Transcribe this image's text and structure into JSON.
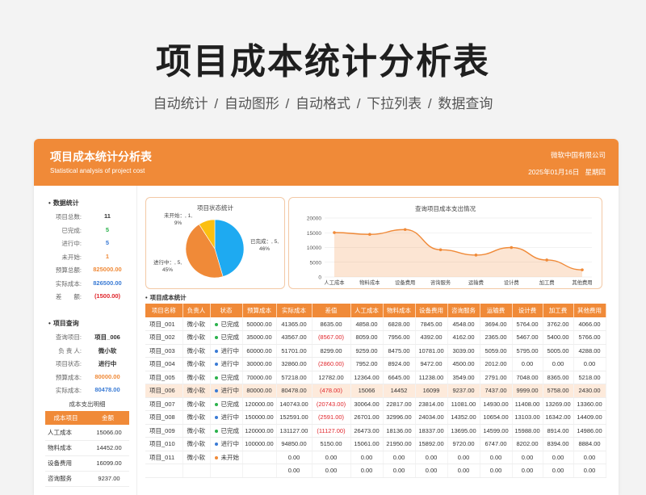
{
  "hero": {
    "title": "项目成本统计分析表",
    "subtitle": "自动统计  /  自动图形   /  自动格式  /  下拉列表  /  数据查询"
  },
  "banner": {
    "title": "项目成本统计分析表",
    "subtitle": "Statistical analysis of project cost",
    "company": "微软中国有限公司",
    "date": "2025年01月16日",
    "weekday": "星期四"
  },
  "stats": {
    "title": "数据统计",
    "items": [
      {
        "label": "项目总数:",
        "value": "11",
        "color": "#333333"
      },
      {
        "label": "已完成:",
        "value": "5",
        "color": "#2bb24c"
      },
      {
        "label": "进行中:",
        "value": "5",
        "color": "#3a7bd5"
      },
      {
        "label": "未开始:",
        "value": "1",
        "color": "#f08a38"
      },
      {
        "label": "预算总额:",
        "value": "825000.00",
        "color": "#f08a38"
      },
      {
        "label": "实际成本:",
        "value": "826500.00",
        "color": "#3a7bd5"
      },
      {
        "label": "差　　额:",
        "value": "(1500.00)",
        "color": "#e0262c"
      }
    ]
  },
  "query": {
    "title": "项目查询",
    "items": [
      {
        "label": "查询项目:",
        "value": "项目_006",
        "color": "#333333"
      },
      {
        "label": "负 责 人:",
        "value": "微小软",
        "color": "#333333"
      },
      {
        "label": "项目状态:",
        "value": "进行中",
        "color": "#333333"
      },
      {
        "label": "预算成本:",
        "value": "80000.00",
        "color": "#f08a38"
      },
      {
        "label": "实际成本:",
        "value": "80478.00",
        "color": "#3a7bd5"
      }
    ],
    "breakdown_title": "成本支出明细",
    "breakdown_headers": [
      "成本项目",
      "金额"
    ],
    "breakdown_rows": [
      [
        "人工成本",
        "15066.00"
      ],
      [
        "物料成本",
        "14452.00"
      ],
      [
        "设备费用",
        "16099.00"
      ],
      [
        "咨询服务",
        "9237.00"
      ]
    ]
  },
  "pie_chart": {
    "title": "项目状态统计",
    "labels": [
      {
        "text": "未开始：, 1,",
        "pct": "9%"
      },
      {
        "text": "已完成：, 5,",
        "pct": "46%"
      },
      {
        "text": "进行中：, 5,",
        "pct": "45%"
      }
    ]
  },
  "chart_data": [
    {
      "type": "pie",
      "title": "项目状态统计",
      "categories": [
        "已完成",
        "进行中",
        "未开始"
      ],
      "values": [
        5,
        5,
        1
      ],
      "percents": [
        46,
        45,
        9
      ],
      "colors": [
        "#1eaaf1",
        "#f08a38",
        "#fbbf10"
      ]
    },
    {
      "type": "area",
      "title": "查询项目成本支出情况",
      "categories": [
        "人工成本",
        "物料成本",
        "设备费用",
        "咨询服务",
        "运输费",
        "设计费",
        "加工费",
        "其他费用"
      ],
      "values": [
        15066,
        14452,
        16099,
        9237,
        7437,
        9999,
        5758,
        2430
      ],
      "ylim": [
        0,
        20000
      ],
      "yticks": [
        "0",
        "5000",
        "10000",
        "15000",
        "20000"
      ],
      "color": "#f08a38"
    }
  ],
  "table": {
    "title": "项目成本统计",
    "headers": [
      "项目名称",
      "负责人",
      "状态",
      "预算成本",
      "实际成本",
      "差值",
      "人工成本",
      "物料成本",
      "设备费用",
      "咨询服务",
      "运输费",
      "设计费",
      "加工费",
      "其他费用"
    ],
    "status_colors": {
      "已完成": "#2bb24c",
      "进行中": "#3a7bd5",
      "未开始": "#f08a38"
    },
    "rows": [
      [
        "项目_001",
        "微小软",
        "已完成",
        "50000.00",
        "41365.00",
        "8635.00",
        "4858.00",
        "6828.00",
        "7845.00",
        "4548.00",
        "3694.00",
        "5764.00",
        "3762.00",
        "4066.00"
      ],
      [
        "项目_002",
        "微小软",
        "已完成",
        "35000.00",
        "43567.00",
        "(8567.00)",
        "8059.00",
        "7956.00",
        "4392.00",
        "4162.00",
        "2365.00",
        "5467.00",
        "5400.00",
        "5766.00"
      ],
      [
        "项目_003",
        "微小软",
        "进行中",
        "60000.00",
        "51701.00",
        "8299.00",
        "9259.00",
        "8475.00",
        "10781.00",
        "3039.00",
        "5059.00",
        "5795.00",
        "5005.00",
        "4288.00"
      ],
      [
        "项目_004",
        "微小软",
        "进行中",
        "30000.00",
        "32860.00",
        "(2860.00)",
        "7952.00",
        "8924.00",
        "9472.00",
        "4500.00",
        "2012.00",
        "0.00",
        "0.00",
        "0.00"
      ],
      [
        "项目_005",
        "微小软",
        "已完成",
        "70000.00",
        "57218.00",
        "12782.00",
        "12364.00",
        "6645.00",
        "11238.00",
        "3549.00",
        "2791.00",
        "7048.00",
        "8365.00",
        "5218.00"
      ],
      [
        "项目_006",
        "微小软",
        "进行中",
        "80000.00",
        "80478.00",
        "(478.00)",
        "15066",
        "14452",
        "16099",
        "9237.00",
        "7437.00",
        "9999.00",
        "5758.00",
        "2430.00"
      ],
      [
        "项目_007",
        "微小软",
        "已完成",
        "120000.00",
        "140743.00",
        "(20743.00)",
        "30064.00",
        "22817.00",
        "23814.00",
        "11081.00",
        "14930.00",
        "11408.00",
        "13269.00",
        "13360.00"
      ],
      [
        "项目_008",
        "微小软",
        "进行中",
        "150000.00",
        "152591.00",
        "(2591.00)",
        "26701.00",
        "32996.00",
        "24034.00",
        "14352.00",
        "10654.00",
        "13103.00",
        "16342.00",
        "14409.00"
      ],
      [
        "项目_009",
        "微小软",
        "已完成",
        "120000.00",
        "131127.00",
        "(11127.00)",
        "26473.00",
        "18136.00",
        "18337.00",
        "13695.00",
        "14599.00",
        "15988.00",
        "8914.00",
        "14986.00"
      ],
      [
        "项目_010",
        "微小软",
        "进行中",
        "100000.00",
        "94850.00",
        "5150.00",
        "15061.00",
        "21950.00",
        "15892.00",
        "9720.00",
        "6747.00",
        "8202.00",
        "8394.00",
        "8884.00"
      ],
      [
        "项目_011",
        "微小软",
        "未开始",
        "",
        "0.00",
        "0.00",
        "0.00",
        "0.00",
        "0.00",
        "0.00",
        "0.00",
        "0.00",
        "0.00",
        "0.00"
      ],
      [
        "",
        "",
        "",
        "",
        "0.00",
        "0.00",
        "0.00",
        "0.00",
        "0.00",
        "0.00",
        "0.00",
        "0.00",
        "0.00",
        "0.00"
      ]
    ]
  }
}
